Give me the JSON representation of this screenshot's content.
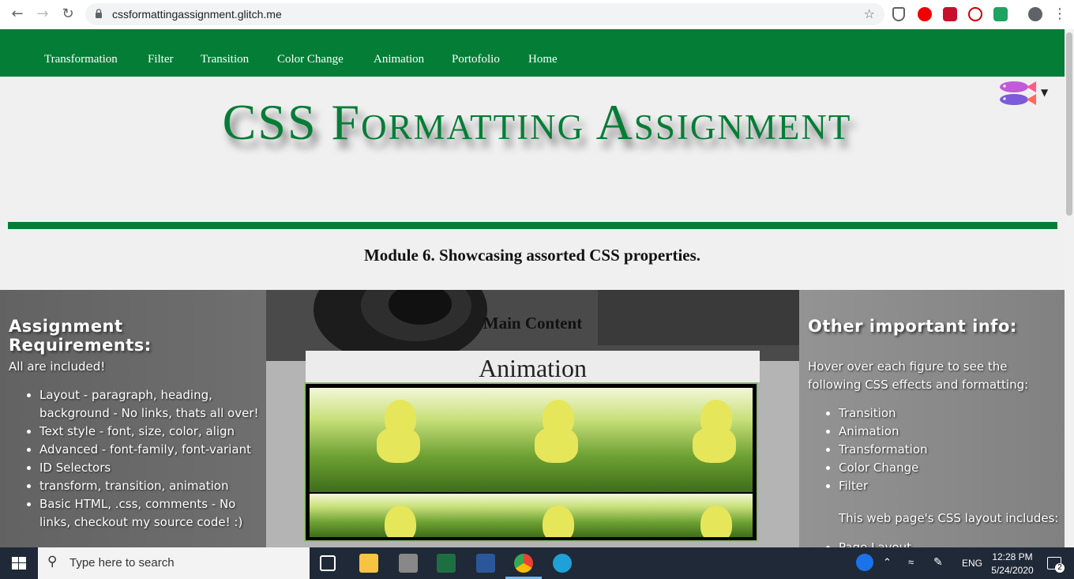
{
  "browser": {
    "url": "cssformattingassignment.glitch.me"
  },
  "nav": {
    "items": [
      "Transformation",
      "Filter",
      "Transition",
      "Color Change",
      "Animation",
      "Portofolio",
      "Home"
    ]
  },
  "header": {
    "title": "CSS Formatting Assignment",
    "subtitle": "Module 6. Showcasing assorted CSS properties."
  },
  "left": {
    "heading": "Assignment Requirements:",
    "intro": "All are included!",
    "items": [
      "Layout - paragraph, heading, background - No links, thats all over!",
      "Text style - font, size, color, align",
      "Advanced - font-family, font-variant",
      "ID Selectors",
      "transform, transition, animation",
      "Basic HTML, .css, comments - No links, checkout my source code! :)"
    ]
  },
  "main": {
    "heading": "Main Content",
    "animation_label": "Animation"
  },
  "right": {
    "heading": "Other important info:",
    "intro": "Hover over each figure to see the following CSS effects and formatting:",
    "items": [
      "Transition",
      "Animation",
      "Transformation",
      "Color Change",
      "Filter"
    ],
    "layout_note": "This web page's CSS layout includes:",
    "layout_items": [
      "Page Layout"
    ]
  },
  "taskbar": {
    "search_placeholder": "Type here to search",
    "lang": "ENG",
    "time": "12:28 PM",
    "date": "5/24/2020",
    "notifications": "2"
  },
  "colors": {
    "brand_green": "#047d36"
  }
}
